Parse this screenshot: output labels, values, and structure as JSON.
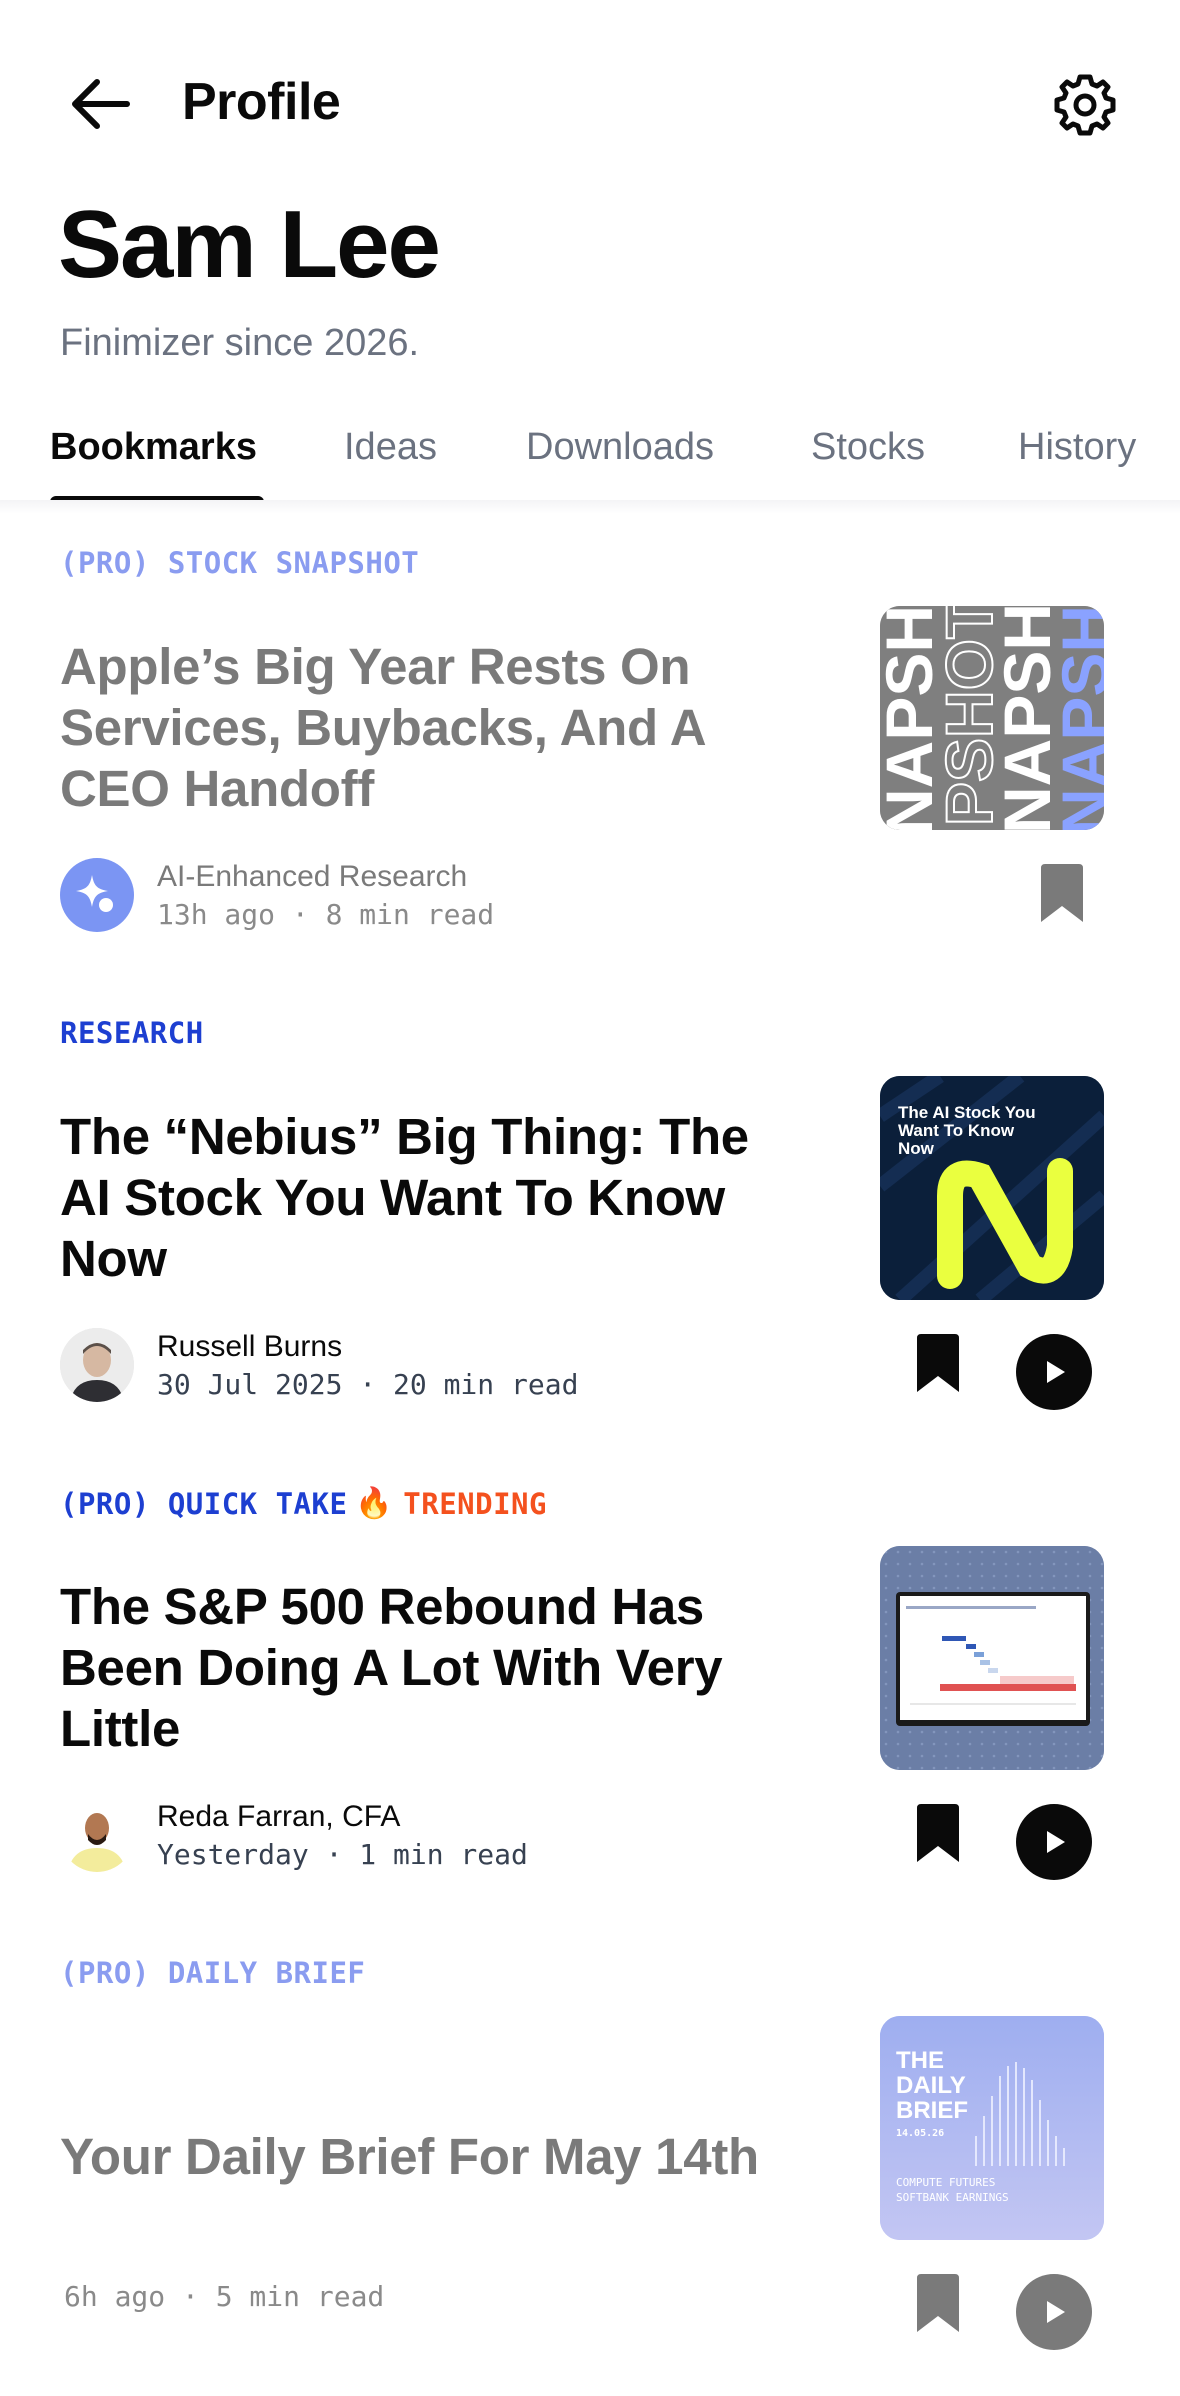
{
  "header": {
    "title": "Profile",
    "back_icon": "arrow-left-icon",
    "settings_icon": "gear-icon"
  },
  "profile": {
    "name": "Sam Lee",
    "since": "Finimizer since 2026."
  },
  "tabs": [
    {
      "label": "Bookmarks",
      "active": true
    },
    {
      "label": "Ideas",
      "active": false
    },
    {
      "label": "Downloads",
      "active": false
    },
    {
      "label": "Stocks",
      "active": false
    },
    {
      "label": "History",
      "active": false
    }
  ],
  "articles": [
    {
      "kicker_pro": "(PRO)",
      "kicker_type": "STOCK SNAPSHOT",
      "title": "Apple’s Big Year Rests On Services, Buybacks, And A CEO Handoff",
      "author": "AI-Enhanced Research",
      "when": "13h ago · 8 min read",
      "thumb_text": "SNAPSHOT",
      "dimmed": true
    },
    {
      "kicker_pro": "",
      "kicker_type": "RESEARCH",
      "title": "The “Nebius” Big Thing: The AI Stock You Want To Know Now",
      "author": "Russell Burns",
      "when": "30 Jul 2025 · 20 min read",
      "thumb_text": "The AI Stock You Want To Know Now",
      "dimmed": false
    },
    {
      "kicker_pro": "(PRO)",
      "kicker_type": "QUICK TAKE",
      "trending": "TRENDING",
      "title": "The S&P 500 Rebound Has Been Doing A Lot With Very Little",
      "author": "Reda Farran, CFA",
      "when": "Yesterday · 1 min read",
      "dimmed": false
    },
    {
      "kicker_pro": "(PRO)",
      "kicker_type": "DAILY BRIEF",
      "title": "Your Daily Brief For May 14th",
      "when": "6h ago · 5 min read",
      "thumb_title": "THE DAILY BRIEF",
      "thumb_date": "14.05.26",
      "thumb_line1": "COMPUTE FUTURES",
      "thumb_line2": "SOFTBANK EARNINGS",
      "dimmed": true
    }
  ],
  "colors": {
    "accent_blue": "#1d3fd1",
    "trending_orange": "#f4511e",
    "muted_text": "#6b7280"
  }
}
